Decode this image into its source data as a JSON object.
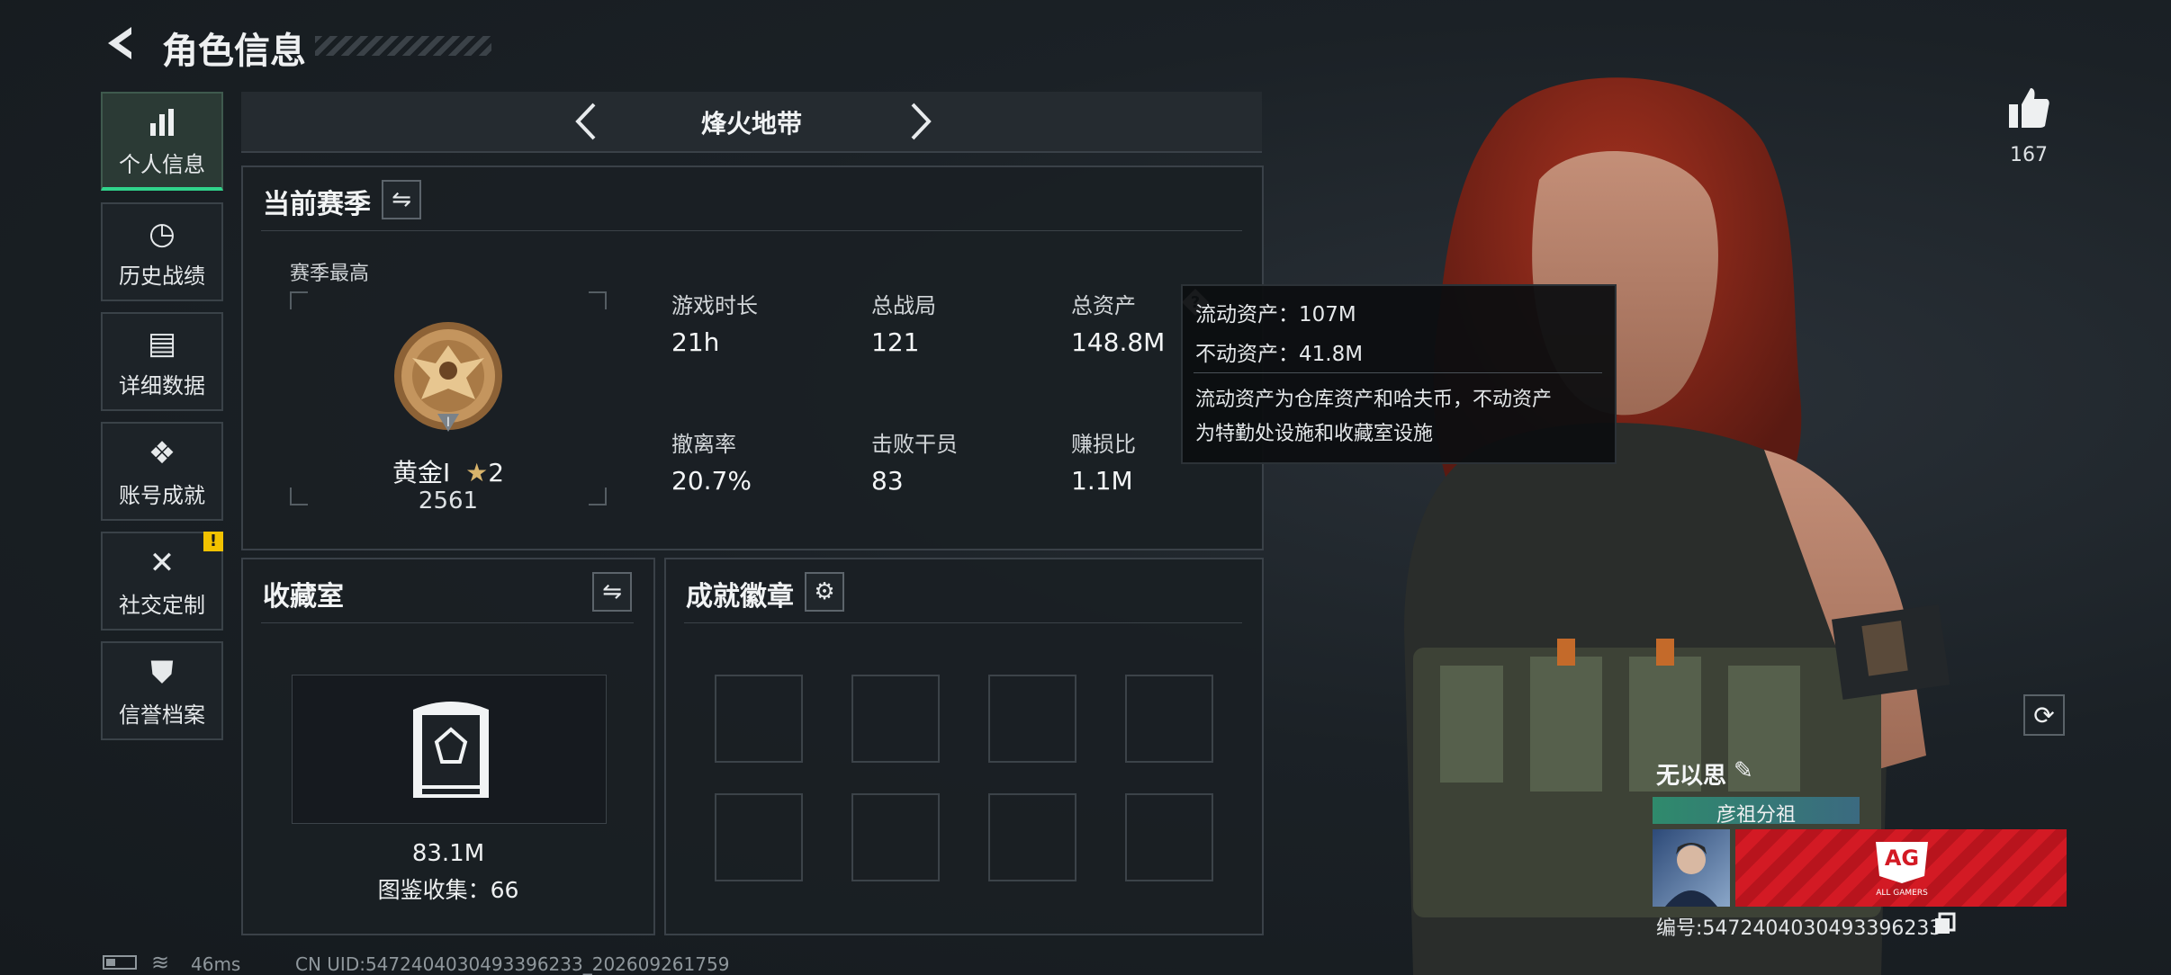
{
  "header": {
    "back_icon": "back-arrow-icon",
    "title": "角色信息"
  },
  "sidebar": {
    "items": [
      {
        "label": "个人信息",
        "icon": "bar-chart-icon",
        "active": true
      },
      {
        "label": "历史战绩",
        "icon": "clock-icon"
      },
      {
        "label": "详细数据",
        "icon": "folder-icon"
      },
      {
        "label": "账号成就",
        "icon": "achievement-icon"
      },
      {
        "label": "社交定制",
        "icon": "tools-icon",
        "alert": "!"
      },
      {
        "label": "信誉档案",
        "icon": "shield-icon"
      }
    ]
  },
  "mode_selector": {
    "label": "烽火地带",
    "prev_icon": "chevron-left-icon",
    "next_icon": "chevron-right-icon"
  },
  "current_season": {
    "title": "当前赛季",
    "season_best_label": "赛季最高",
    "rank": {
      "name": "黄金Ⅰ",
      "stars": "2",
      "score": "2561",
      "emblem_numeral": "Ⅰ"
    },
    "stats": [
      {
        "label": "游戏时长",
        "value": "21h"
      },
      {
        "label": "总战局",
        "value": "121"
      },
      {
        "label": "总资产",
        "value": "148.8M"
      },
      {
        "label": "撤离率",
        "value": "20.7%"
      },
      {
        "label": "击败干员",
        "value": "83"
      },
      {
        "label": "赚损比",
        "value": "1.1M"
      }
    ]
  },
  "tooltip": {
    "liquid": "流动资产：107M",
    "fixed": "不动资产：41.8M",
    "desc_line1": "流动资产为仓库资产和哈夫币，不动资产",
    "desc_line2": "为特勤处设施和收藏室设施"
  },
  "collection": {
    "title": "收藏室",
    "value": "83.1M",
    "catalog": "图鉴收集：66"
  },
  "achievements": {
    "title": "成就徽章",
    "slots": 8
  },
  "profile": {
    "likes": "167",
    "name": "无以思",
    "subtitle": "彦祖分祖",
    "banner_text": "AG",
    "banner_subtext": "ALL GAMERS",
    "id_line": "编号:5472404030493396233"
  },
  "status_bar": {
    "ping": "46ms",
    "uid": "CN UID:5472404030493396233_202609261759"
  },
  "colors": {
    "accent": "#30d48b",
    "alert": "#f2c200",
    "banner_red": "#d31a24"
  }
}
